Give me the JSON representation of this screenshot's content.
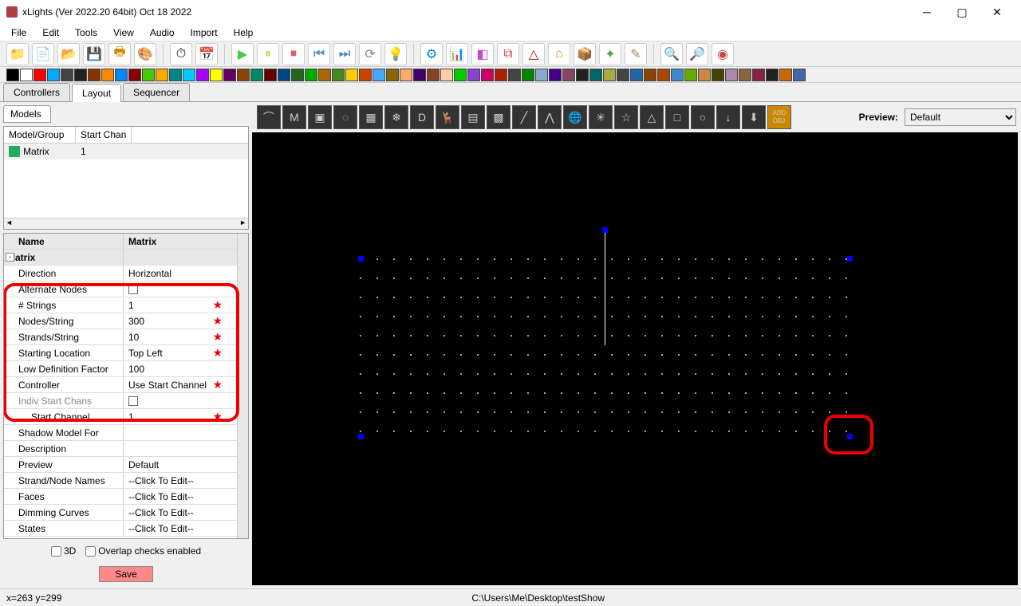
{
  "title": "xLights (Ver 2022.20 64bit) Oct 18 2022",
  "menu": [
    "File",
    "Edit",
    "Tools",
    "View",
    "Audio",
    "Import",
    "Help"
  ],
  "maintabs": [
    "Controllers",
    "Layout",
    "Sequencer"
  ],
  "active_tab": "Layout",
  "models_header": "Models",
  "list_cols": [
    "Model/Group",
    "Start Chan"
  ],
  "list_rows": [
    {
      "name": "Matrix",
      "chan": "1"
    }
  ],
  "prop_header": {
    "name": "Name",
    "value": "Matrix"
  },
  "prop_category": "Matrix",
  "props": [
    {
      "name": "Direction",
      "value": "Horizontal",
      "star": false
    },
    {
      "name": "Alternate Nodes",
      "value": "",
      "chk": true,
      "star": false
    },
    {
      "name": "# Strings",
      "value": "1",
      "star": true
    },
    {
      "name": "Nodes/String",
      "value": "300",
      "star": true
    },
    {
      "name": "Strands/String",
      "value": "10",
      "star": true
    },
    {
      "name": "Starting Location",
      "value": "Top Left",
      "star": true
    },
    {
      "name": "Low Definition Factor",
      "value": "100",
      "star": false
    },
    {
      "name": "Controller",
      "value": "Use Start Channel",
      "star": true
    },
    {
      "name": "Indiv Start Chans",
      "value": "",
      "chk": true,
      "disabled": true,
      "star": false
    },
    {
      "name": "Start Channel",
      "value": "1",
      "indent": true,
      "star": true
    },
    {
      "name": "Shadow Model For",
      "value": "",
      "star": false
    },
    {
      "name": "Description",
      "value": "",
      "star": false
    },
    {
      "name": "Preview",
      "value": "Default",
      "star": false
    },
    {
      "name": "Strand/Node Names",
      "value": "--Click To Edit--",
      "star": false
    },
    {
      "name": "Faces",
      "value": "--Click To Edit--",
      "star": false
    },
    {
      "name": "Dimming Curves",
      "value": "--Click To Edit--",
      "star": false
    },
    {
      "name": "States",
      "value": "--Click To Edit--",
      "star": false
    }
  ],
  "checkbox_3d": "3D",
  "checkbox_overlap": "Overlap checks enabled",
  "save_label": "Save",
  "preview_label": "Preview:",
  "preview_value": "Default",
  "status_coord": "x=263 y=299",
  "status_path": "C:\\Users\\Me\\Desktop\\testShow",
  "toolbar1_icons": [
    "new-folder",
    "new-seq",
    "open",
    "save",
    "save-all",
    "palette",
    "",
    "clock",
    "calendar",
    "",
    "play",
    "pause",
    "stop",
    "prev",
    "next",
    "loop",
    "bulb",
    "",
    "gear",
    "bars",
    "props",
    "dup",
    "tree",
    "house",
    "pkg",
    "sparkle",
    "brush",
    "",
    "zoom-in",
    "zoom-out",
    "help"
  ],
  "model_tb_icons": [
    "arch",
    "M",
    "window",
    "circle",
    "grid",
    "snow",
    "DMX",
    "deer",
    "panel",
    "matrix",
    "line",
    "poly",
    "globe",
    "star8",
    "star",
    "tree",
    "square",
    "ring",
    "import",
    "download",
    "addobj"
  ]
}
